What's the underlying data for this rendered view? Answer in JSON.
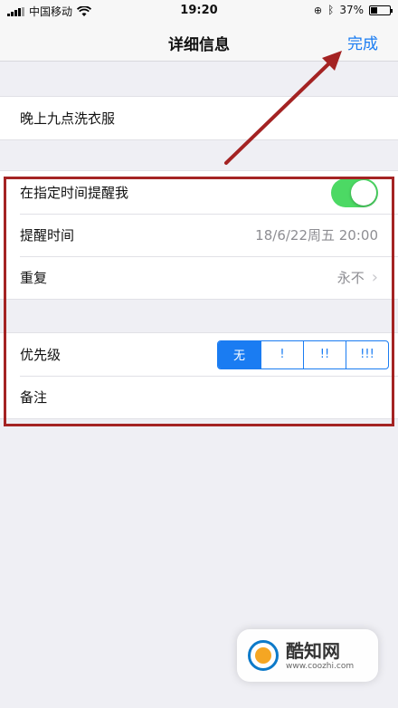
{
  "status_bar": {
    "carrier": "中国移动",
    "time": "19:20",
    "battery_percent": "37%",
    "battery_level": 0.37
  },
  "nav": {
    "title": "详细信息",
    "done_label": "完成"
  },
  "task": {
    "title": "晚上九点洗衣服"
  },
  "reminder": {
    "remind_label": "在指定时间提醒我",
    "remind_enabled": true,
    "time_label": "提醒时间",
    "time_value": "18/6/22周五 20:00",
    "repeat_label": "重复",
    "repeat_value": "永不"
  },
  "priority": {
    "label": "优先级",
    "options": [
      "无",
      "!",
      "!!",
      "!!!"
    ],
    "selected": "无"
  },
  "notes": {
    "label": "备注"
  },
  "watermark": {
    "title": "酷知网",
    "url": "www.coozhi.com"
  },
  "colors": {
    "accent": "#1a7cf2",
    "toggle_on": "#4cd964",
    "annotation": "#a42323"
  }
}
